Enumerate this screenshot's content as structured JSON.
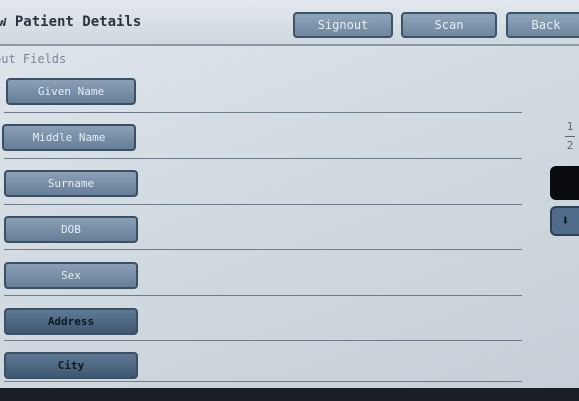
{
  "header": {
    "title": "w Patient Details",
    "buttons": {
      "signout": "Signout",
      "scan": "Scan",
      "back": "Back"
    }
  },
  "section": {
    "label": "put Fields"
  },
  "fields": [
    {
      "label": "Given Name"
    },
    {
      "label": "Middle Name"
    },
    {
      "label": "Surname"
    },
    {
      "label": "DOB"
    },
    {
      "label": "Sex"
    },
    {
      "label": "Address"
    },
    {
      "label": "City"
    }
  ],
  "pager": {
    "current": "1",
    "total": "2"
  },
  "colors": {
    "button": "#7a93ab",
    "button_dark": "#4e6883",
    "screen": "#d6dee5"
  },
  "icons": {
    "down": "arrow-down-icon"
  }
}
